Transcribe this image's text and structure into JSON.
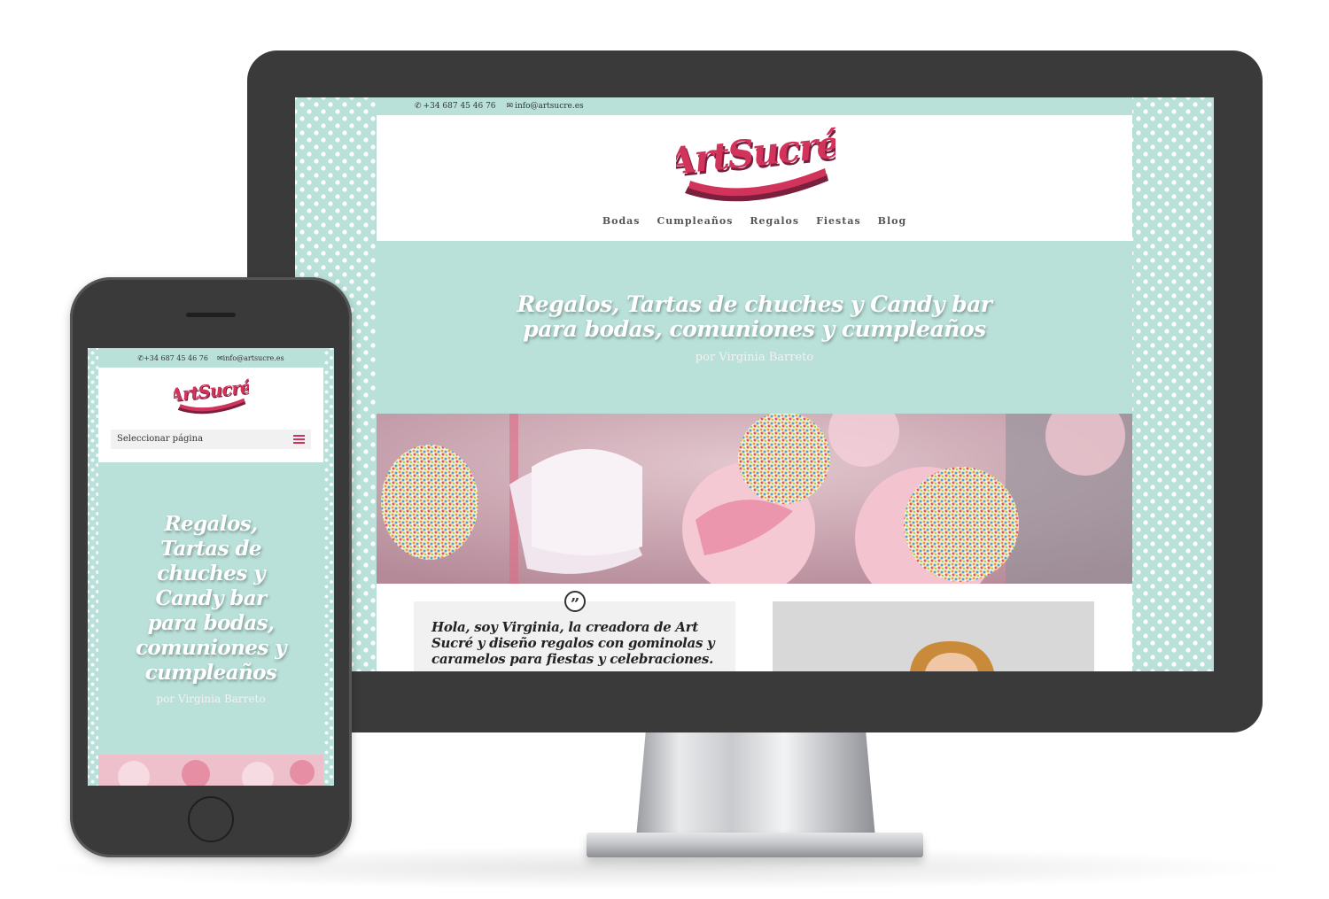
{
  "topbar": {
    "phone": "+34 687 45 46 76",
    "email": "info@artsucre.es"
  },
  "brand": {
    "logo_text": "ArtSucré",
    "primary_color": "#d1335b",
    "accent_color": "#b9e1d9"
  },
  "nav": {
    "items": [
      "Bodas",
      "Cumpleaños",
      "Regalos",
      "Fiestas",
      "Blog"
    ]
  },
  "hero": {
    "title": "Regalos, Tartas de chuches y Candy bar para bodas, comuniones y cumpleaños",
    "byline": "por Virginia Barreto"
  },
  "intro": {
    "quote": "Hola, soy Virginia, la creadora de Art Sucré y diseño regalos con gominolas y caramelos para fiestas y celebraciones."
  },
  "mobile": {
    "select_label": "Seleccionar página"
  }
}
